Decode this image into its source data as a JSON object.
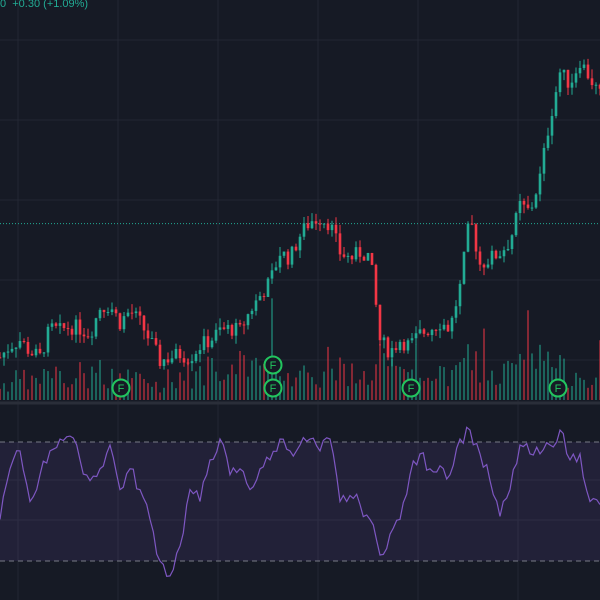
{
  "header": {
    "last_digit": "0",
    "change": "+0.30",
    "change_pct": "(+1.09%)"
  },
  "colors": {
    "bg": "#161a25",
    "up": "#22ab94",
    "down": "#f23645",
    "rsi": "#7e57c2",
    "rsi_band": "#7e57c2",
    "grid": "#232733",
    "marker": "#22c55e"
  },
  "chart_data": [
    {
      "type": "candlestick",
      "title": "Price",
      "last_price_line": 27.8,
      "closes": [
        24.93,
        25.18,
        25.3,
        25.05,
        24.93,
        25.55,
        25.5,
        25.6,
        25.55,
        25.43,
        26.0,
        26.05,
        25.68,
        25.93,
        25.68,
        25.3,
        24.85,
        24.93,
        25.0,
        24.93,
        25.18,
        25.3,
        25.5,
        25.55,
        25.5,
        25.93,
        26.25,
        26.55,
        27.18,
        27.05,
        27.55,
        27.85,
        27.93,
        27.8,
        27.18,
        27.05,
        27.18,
        27.1,
        25.3,
        25.05,
        25.3,
        25.18,
        25.43,
        25.55,
        25.68,
        25.55,
        26.43,
        27.93,
        26.93,
        27.05,
        27.18,
        27.43,
        28.18,
        28.05,
        28.8,
        30.05,
        31.05,
        30.8,
        31.3,
        30.93,
        30.55
      ],
      "volume": [
        2,
        2,
        3,
        2,
        3,
        4,
        3,
        2,
        3,
        3,
        4,
        3,
        2,
        3,
        3,
        2,
        2,
        3,
        2,
        3,
        3,
        4,
        3,
        3,
        4,
        5,
        4,
        4,
        5,
        3,
        4,
        3,
        3,
        3,
        4,
        3,
        3,
        3,
        6,
        4,
        3,
        3,
        3,
        4,
        3,
        3,
        4,
        6,
        4,
        3,
        3,
        4,
        5,
        4,
        6,
        5,
        4,
        3,
        4,
        3,
        3
      ],
      "events": [
        {
          "label": "F",
          "index": 12.1
        },
        {
          "label": "F",
          "index": 27.3
        },
        {
          "label": "F",
          "index": 27.3
        },
        {
          "label": "F",
          "index": 41.1
        },
        {
          "label": "F",
          "index": 55.8
        }
      ],
      "ylim": [
        23.8,
        32.6
      ]
    },
    {
      "type": "line",
      "title": "RSI",
      "values": [
        44,
        61,
        67,
        50,
        59,
        67,
        71,
        72,
        64,
        57,
        61,
        69,
        54,
        61,
        54,
        44,
        30,
        25,
        35,
        54,
        50,
        64,
        71,
        59,
        61,
        54,
        61,
        64,
        71,
        67,
        69,
        71,
        67,
        71,
        50,
        52,
        49,
        44,
        32,
        39,
        44,
        59,
        66,
        61,
        62,
        59,
        71,
        74,
        66,
        57,
        45,
        54,
        69,
        66,
        66,
        69,
        74,
        64,
        66,
        50,
        49
      ],
      "bands": [
        70,
        30
      ],
      "ylim": [
        20,
        80
      ]
    }
  ]
}
